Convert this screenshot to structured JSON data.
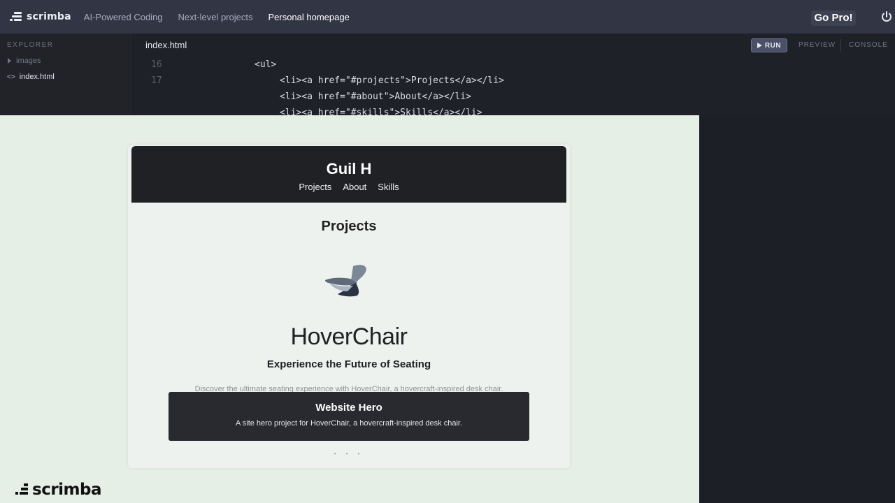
{
  "topbar": {
    "logo_text": "scrimba",
    "breadcrumbs": [
      "AI-Powered Coding",
      "Next-level projects",
      "Personal homepage"
    ],
    "go_pro_label": "Go Pro!"
  },
  "sidebar": {
    "title": "EXPLORER",
    "items": [
      {
        "label": "images",
        "type": "folder"
      },
      {
        "label": "index.html",
        "type": "file"
      }
    ]
  },
  "editor": {
    "active_tab": "index.html",
    "run_label": "RUN",
    "preview_label": "PREVIEW",
    "console_label": "CONSOLE",
    "line_numbers": [
      "16",
      "17"
    ],
    "code_lines": [
      "<ul>",
      "<li><a href=\"#projects\">Projects</a></li>",
      "<li><a href=\"#about\">About</a></li>",
      "<li><a href=\"#skills\">Skills</a></li>"
    ]
  },
  "preview": {
    "site_name": "Guil H",
    "nav": [
      "Projects",
      "About",
      "Skills"
    ],
    "section_title": "Projects",
    "hero_title": "HoverChair",
    "hero_subtitle": "Experience the Future of Seating",
    "hero_description": "Discover the ultimate seating experience with HoverChair, a hovercraft-inspired desk chair.",
    "card_title": "Website Hero",
    "card_description": "A site hero project for HoverChair, a hovercraft-inspired desk chair.",
    "pagination": "• • •"
  },
  "watermark": {
    "text": "scrimba"
  }
}
